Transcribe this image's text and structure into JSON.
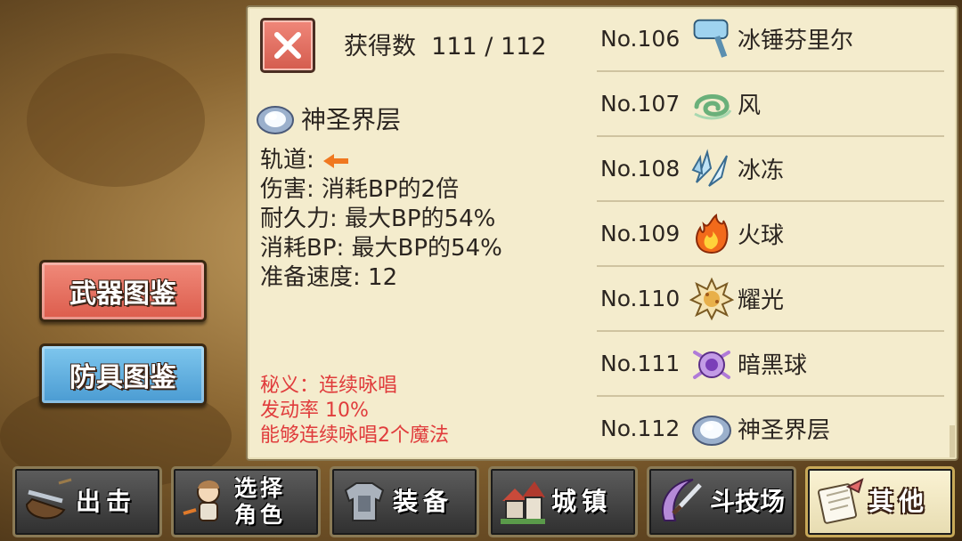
{
  "panel": {
    "count_label": "获得数",
    "count_value": "111 / 112",
    "item": {
      "name": "神圣界层",
      "icon": "holy-barrier-icon",
      "stats": [
        {
          "label": "轨道:",
          "value": "",
          "icon": "left-arrow-icon"
        },
        {
          "label": "伤害:",
          "value": " 消耗BP的2倍"
        },
        {
          "label": "耐久力:",
          "value": " 最大BP的54%"
        },
        {
          "label": "消耗BP:",
          "value": " 最大BP的54%"
        },
        {
          "label": "准备速度:",
          "value": " 12"
        }
      ],
      "secret": [
        "秘义：连续咏唱",
        "发动率 10%",
        "能够连续咏唱2个魔法"
      ]
    },
    "list": [
      {
        "num": "No.106",
        "name": "冰锤芬里尔",
        "icon": "ice-hammer-icon"
      },
      {
        "num": "No.107",
        "name": "风",
        "icon": "wind-icon"
      },
      {
        "num": "No.108",
        "name": "冰冻",
        "icon": "ice-shard-icon"
      },
      {
        "num": "No.109",
        "name": "火球",
        "icon": "fireball-icon"
      },
      {
        "num": "No.110",
        "name": "耀光",
        "icon": "radiance-icon"
      },
      {
        "num": "No.111",
        "name": "暗黑球",
        "icon": "dark-orb-icon"
      },
      {
        "num": "No.112",
        "name": "神圣界层",
        "icon": "holy-barrier-icon"
      }
    ]
  },
  "side": {
    "weapons": "武器图鉴",
    "armor": "防具图鉴"
  },
  "nav": [
    {
      "label": "出击",
      "icon": "sortie-icon"
    },
    {
      "label": "选择角色",
      "line1": "选择",
      "line2": "角色",
      "icon": "character-icon"
    },
    {
      "label": "装备",
      "icon": "armor-icon"
    },
    {
      "label": "城镇",
      "icon": "town-icon"
    },
    {
      "label": "斗技场",
      "icon": "arena-icon"
    },
    {
      "label": "其他",
      "icon": "scroll-icon",
      "active": true
    }
  ],
  "colors": {
    "close": "#d45c4e",
    "weapons": "#e86f60",
    "armor": "#5aa9dc",
    "secret": "#e03c3c",
    "panel": "#f4eccd"
  }
}
